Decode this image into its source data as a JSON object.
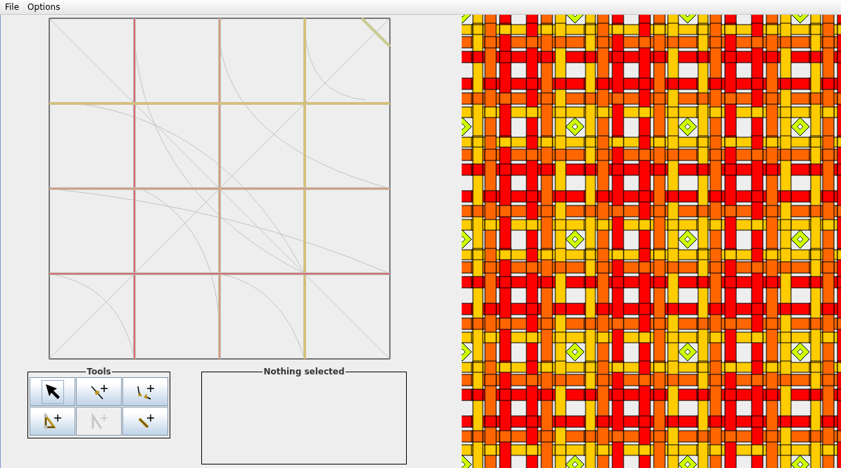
{
  "menu": [
    {
      "label": "File"
    },
    {
      "label": "Options"
    }
  ],
  "tools": {
    "title": "Tools",
    "buttons": [
      {
        "kind": "select",
        "selected": true,
        "disabled": false
      },
      {
        "kind": "point",
        "selected": false,
        "disabled": false
      },
      {
        "kind": "angle",
        "selected": false,
        "disabled": false
      },
      {
        "kind": "triangle",
        "selected": false,
        "disabled": false
      },
      {
        "kind": "polyline",
        "selected": false,
        "disabled": true
      },
      {
        "kind": "segment",
        "selected": false,
        "disabled": false
      }
    ]
  },
  "selection_panel": {
    "title": "Nothing selected"
  }
}
